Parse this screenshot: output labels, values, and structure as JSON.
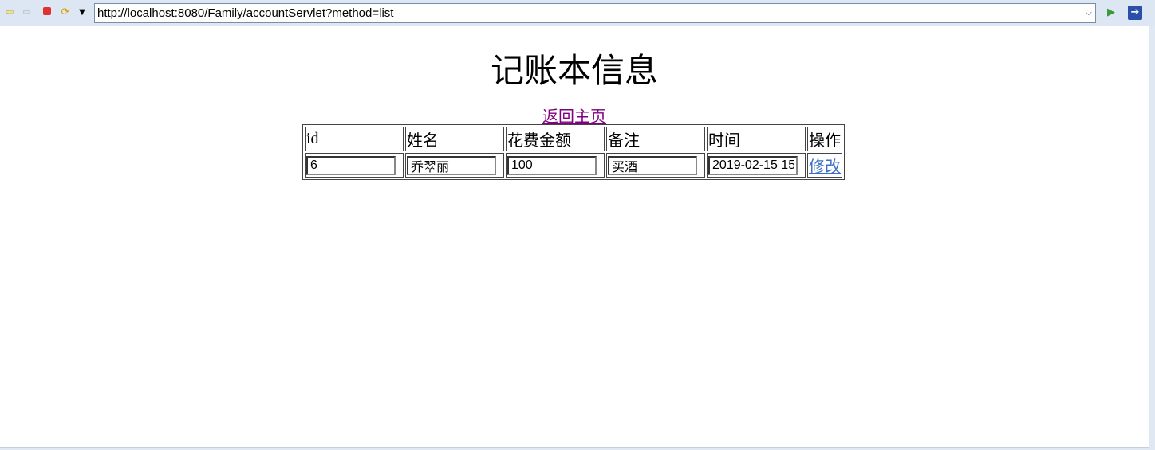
{
  "toolbar": {
    "url": "http://localhost:8080/Family/accountServlet?method=list",
    "icons": [
      "back-icon",
      "forward-icon",
      "stop-icon",
      "refresh-icon",
      "dropdown-icon",
      "go-icon",
      "open-external-icon"
    ]
  },
  "page": {
    "title": "记账本信息",
    "home_link": "返回主页",
    "table": {
      "headers": [
        "id",
        "姓名",
        "花费金额",
        "备注",
        "时间",
        "操作"
      ],
      "rows": [
        {
          "id": "6",
          "name": "乔翠丽",
          "amount": "100",
          "note": "买酒",
          "time": "2019-02-15 15",
          "action": "修改"
        }
      ]
    }
  }
}
